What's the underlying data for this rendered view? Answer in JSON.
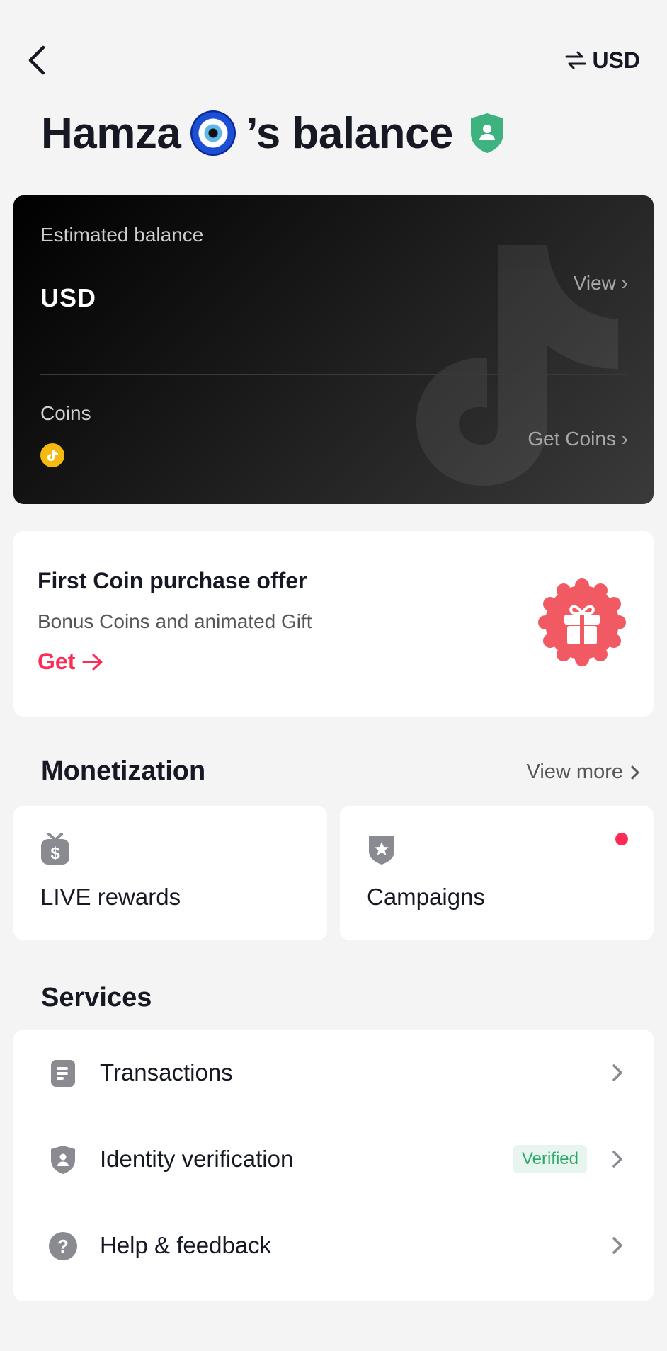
{
  "header": {
    "currency_label": "USD",
    "currency_icon": "swap-arrows-icon",
    "back_icon": "back-chevron-icon"
  },
  "title": {
    "name": "Hamza",
    "emoji": "nazar-amulet-emoji",
    "suffix": "’s balance",
    "badge_icon": "verified-shield-icon",
    "badge_color": "#3fb37f"
  },
  "balance_card": {
    "estimated_label": "Estimated balance",
    "currency": "USD",
    "view_label": "View ›",
    "coins_label": "Coins",
    "get_coins_label": "Get Coins ›",
    "coin_icon": "coin-icon",
    "coin_color": "#f5b90f"
  },
  "offer": {
    "title": "First Coin purchase offer",
    "subtitle": "Bonus Coins and animated Gift",
    "cta": "Get",
    "cta_icon": "arrow-right-icon",
    "accent": "#fe2c55",
    "gift_icon": "gift-icon"
  },
  "monetization": {
    "title": "Monetization",
    "view_more": "View more",
    "cards": [
      {
        "label": "LIVE rewards",
        "icon": "money-tv-icon"
      },
      {
        "label": "Campaigns",
        "icon": "star-shield-icon",
        "has_notification_dot": true
      }
    ]
  },
  "services": {
    "title": "Services",
    "items": [
      {
        "label": "Transactions",
        "icon": "document-icon"
      },
      {
        "label": "Identity verification",
        "icon": "person-shield-icon",
        "badge": "Verified"
      },
      {
        "label": "Help & feedback",
        "icon": "question-circle-icon"
      }
    ]
  }
}
